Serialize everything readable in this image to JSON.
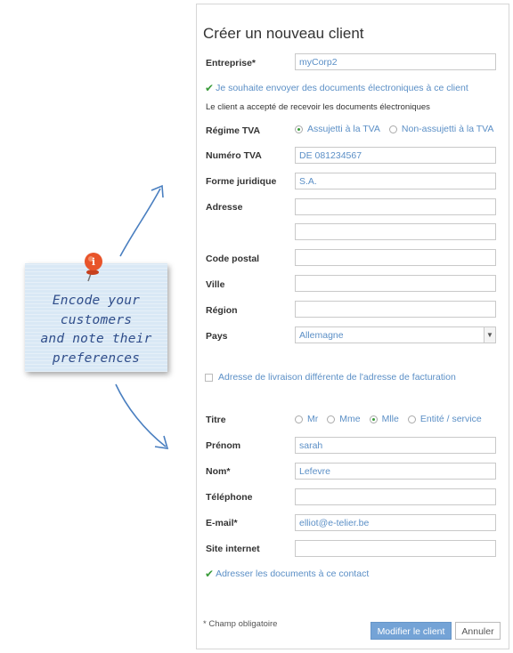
{
  "note": {
    "lines": [
      "Encode your",
      "customers",
      "and note their",
      "preferences"
    ]
  },
  "form": {
    "title": "Créer un nouveau client",
    "entreprise": {
      "label": "Entreprise*",
      "value": "myCorp2"
    },
    "electronic_docs": {
      "label": "Je souhaite envoyer des documents électroniques à ce client",
      "checked": true
    },
    "accepted_info": "Le client a accepté de recevoir les documents électroniques",
    "regime_tva": {
      "label": "Régime TVA",
      "options": [
        "Assujetti à la TVA",
        "Non-assujetti à la TVA"
      ],
      "selected": "Assujetti à la TVA"
    },
    "numero_tva": {
      "label": "Numéro TVA",
      "value": "DE 081234567"
    },
    "forme_juridique": {
      "label": "Forme juridique",
      "value": "S.A."
    },
    "adresse": {
      "label": "Adresse",
      "value1": "",
      "value2": ""
    },
    "code_postal": {
      "label": "Code postal",
      "value": ""
    },
    "ville": {
      "label": "Ville",
      "value": ""
    },
    "region": {
      "label": "Région",
      "value": ""
    },
    "pays": {
      "label": "Pays",
      "value": "Allemagne"
    },
    "delivery_address": {
      "label": "Adresse de livraison différente de l'adresse de facturation",
      "checked": false
    },
    "titre": {
      "label": "Titre",
      "options": [
        "Mr",
        "Mme",
        "Mlle",
        "Entité / service"
      ],
      "selected": "Mlle"
    },
    "prenom": {
      "label": "Prénom",
      "value": "sarah"
    },
    "nom": {
      "label": "Nom*",
      "value": "Lefevre"
    },
    "telephone": {
      "label": "Téléphone",
      "value": ""
    },
    "email": {
      "label": "E-mail*",
      "value": "elliot@e-telier.be"
    },
    "site": {
      "label": "Site internet",
      "value": ""
    },
    "address_docs": {
      "label": "Adresser les documents à ce contact",
      "checked": true
    },
    "required_note": "* Champ obligatoire",
    "submit_label": "Modifier le client",
    "cancel_label": "Annuler"
  },
  "colors": {
    "accent": "#74a3d6",
    "link": "#5b8fc6",
    "check": "#3a9b3a",
    "pin": "#e8542a"
  }
}
